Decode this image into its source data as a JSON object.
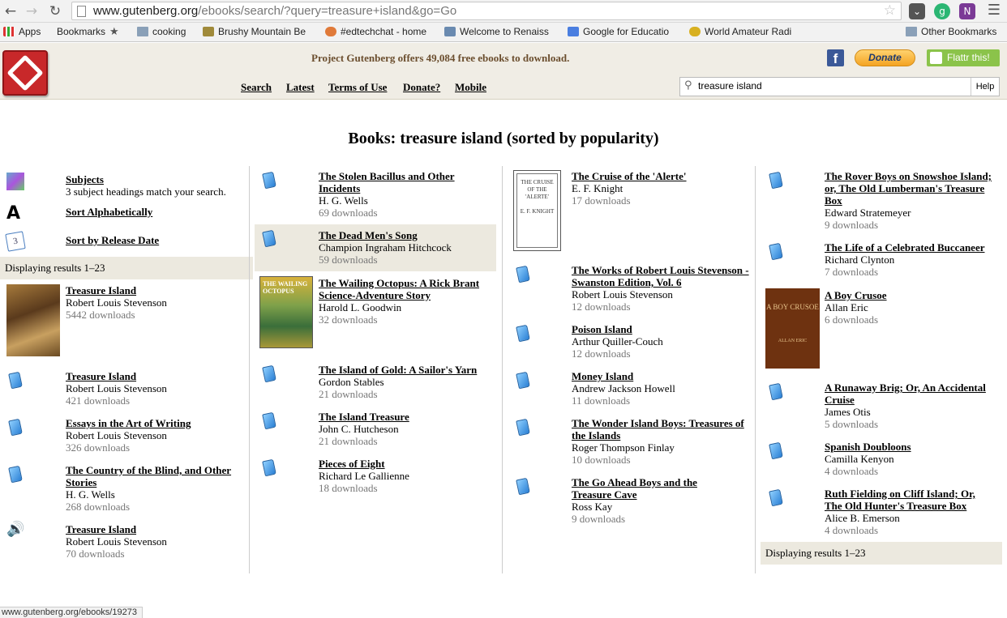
{
  "browser": {
    "url_host": "www.gutenberg.org",
    "url_path": "/ebooks/search/?query=treasure+island&go=Go",
    "bookmarks": [
      {
        "label": "Apps",
        "icon": "apps-icon"
      },
      {
        "label": "Bookmarks",
        "icon": "star-icon"
      },
      {
        "label": "cooking",
        "icon": "folder-icon"
      },
      {
        "label": "Brushy Mountain Be",
        "icon": "site-icon"
      },
      {
        "label": "#edtechchat - home",
        "icon": "site-icon"
      },
      {
        "label": "Welcome to Renaiss",
        "icon": "site-icon"
      },
      {
        "label": "Google for Educatio",
        "icon": "google-icon"
      },
      {
        "label": "World Amateur Radi",
        "icon": "site-icon"
      },
      {
        "label": "Other Bookmarks",
        "icon": "folder-icon"
      }
    ],
    "status_url": "www.gutenberg.org/ebooks/19273"
  },
  "header": {
    "tagline": "Project Gutenberg offers 49,084 free ebooks to download.",
    "facebook": "f",
    "donate": "Donate",
    "flattr": "Flattr this!",
    "nav": [
      "Search",
      "Latest",
      "Terms of Use",
      "Donate?",
      "Mobile"
    ],
    "search_value": "treasure island",
    "help": "Help"
  },
  "page_title": "Books: treasure island (sorted by popularity)",
  "sidebar": {
    "subjects_title": "Subjects",
    "subjects_note": "3 subject headings match your search.",
    "sort_alpha": "Sort Alphabetically",
    "sort_release": "Sort by Release Date",
    "displaying": "Displaying results 1–23"
  },
  "columns": [
    [
      {
        "title": "Treasure Island",
        "author": "Robert Louis Stevenson",
        "downloads": "5442 downloads",
        "icon": "cover-treasure-island"
      },
      {
        "title": "Treasure Island",
        "author": "Robert Louis Stevenson",
        "downloads": "421 downloads",
        "icon": "book-icon"
      },
      {
        "title": "Essays in the Art of Writing",
        "author": "Robert Louis Stevenson",
        "downloads": "326 downloads",
        "icon": "book-icon"
      },
      {
        "title": "The Country of the Blind, and Other Stories",
        "author": "H. G. Wells",
        "downloads": "268 downloads",
        "icon": "book-icon"
      },
      {
        "title": "Treasure Island",
        "author": "Robert Louis Stevenson",
        "downloads": "70 downloads",
        "icon": "audio-icon"
      }
    ],
    [
      {
        "title": "The Stolen Bacillus and Other Incidents",
        "author": "H. G. Wells",
        "downloads": "69 downloads",
        "icon": "book-icon"
      },
      {
        "title": "The Dead Men's Song",
        "author": "Champion Ingraham Hitchcock",
        "downloads": "59 downloads",
        "icon": "book-icon"
      },
      {
        "title": "The Wailing Octopus: A Rick Brant Science-Adventure Story",
        "author": "Harold L. Goodwin",
        "downloads": "32 downloads",
        "icon": "cover-wailing-octopus"
      },
      {
        "title": "The Island of Gold: A Sailor's Yarn",
        "author": "Gordon Stables",
        "downloads": "21 downloads",
        "icon": "book-icon"
      },
      {
        "title": "The Island Treasure",
        "author": "John C. Hutcheson",
        "downloads": "21 downloads",
        "icon": "book-icon"
      },
      {
        "title": "Pieces of Eight",
        "author": "Richard Le Gallienne",
        "downloads": "18 downloads",
        "icon": "book-icon"
      }
    ],
    [
      {
        "title": "The Cruise of the 'Alerte'",
        "author": "E. F. Knight",
        "downloads": "17 downloads",
        "icon": "cover-alerte"
      },
      {
        "title": "The Works of Robert Louis Stevenson - Swanston Edition, Vol. 6",
        "author": "Robert Louis Stevenson",
        "downloads": "12 downloads",
        "icon": "book-icon"
      },
      {
        "title": "Poison Island",
        "author": "Arthur Quiller-Couch",
        "downloads": "12 downloads",
        "icon": "book-icon"
      },
      {
        "title": "Money Island",
        "author": "Andrew Jackson Howell",
        "downloads": "11 downloads",
        "icon": "book-icon"
      },
      {
        "title": "The Wonder Island Boys: Treasures of the Islands",
        "author": "Roger Thompson Finlay",
        "downloads": "10 downloads",
        "icon": "book-icon"
      },
      {
        "title": "The Go Ahead Boys and the Treasure Cave",
        "author": "Ross Kay",
        "downloads": "9 downloads",
        "icon": "book-icon"
      }
    ],
    [
      {
        "title": "The Rover Boys on Snowshoe Island; or, The Old Lumberman's Treasure Box",
        "author": "Edward Stratemeyer",
        "downloads": "9 downloads",
        "icon": "book-icon"
      },
      {
        "title": "The Life of a Celebrated Buccaneer",
        "author": "Richard Clynton",
        "downloads": "7 downloads",
        "icon": "book-icon"
      },
      {
        "title": "A Boy Crusoe",
        "author": "Allan Eric",
        "downloads": "6 downloads",
        "icon": "cover-boy-crusoe"
      },
      {
        "title": "A Runaway Brig; Or, An Accidental Cruise",
        "author": "James Otis",
        "downloads": "5 downloads",
        "icon": "book-icon"
      },
      {
        "title": "Spanish Doubloons",
        "author": "Camilla Kenyon",
        "downloads": "4 downloads",
        "icon": "book-icon"
      },
      {
        "title": "Ruth Fielding on Cliff Island; Or, The Old Hunter's Treasure Box",
        "author": "Alice B. Emerson",
        "downloads": "4 downloads",
        "icon": "book-icon"
      }
    ]
  ],
  "footer_displaying": "Displaying results 1–23",
  "covers": {
    "alerte_text": "THE CRUISE OF THE 'ALERTE'",
    "alerte_author": "E. F. KNIGHT",
    "boy_crusoe_text": "A BOY CRUSOE",
    "boy_crusoe_author": "ALLAN ERIC",
    "wailing_text": "THE WAILING OCTOPUS"
  }
}
